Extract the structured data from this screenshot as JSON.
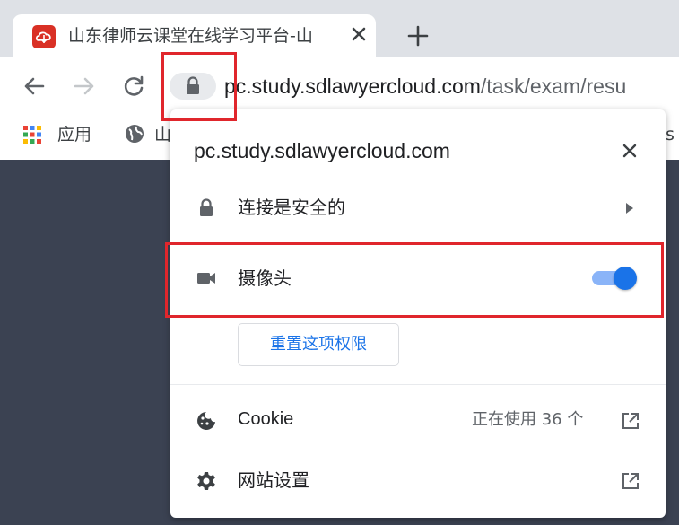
{
  "tab": {
    "title": "山东律师云课堂在线学习平台-山"
  },
  "address_bar": {
    "host": "pc.study.sdlawyercloud.com",
    "path": "/task/exam/resu"
  },
  "bookmarks": {
    "apps_label": "应用",
    "item_fragment_left": "山",
    "item_fragment_right": "s"
  },
  "popup": {
    "site": "pc.study.sdlawyercloud.com",
    "connection_label": "连接是安全的",
    "camera_label": "摄像头",
    "camera_enabled": true,
    "reset_label": "重置这项权限",
    "cookie_label": "Cookie",
    "cookie_status": "正在使用 36 个",
    "site_settings_label": "网站设置"
  },
  "colors": {
    "annotation": "#e0262c",
    "toggle_on": "#1a73e8",
    "link": "#1a73e8",
    "page_background": "#3b4252"
  },
  "icons": {
    "favicon": "red-cloud-logo",
    "lock": "lock-icon",
    "camera": "camera-icon",
    "cookie": "cookie-icon",
    "settings": "gear-icon",
    "external": "open-in-new-icon"
  }
}
